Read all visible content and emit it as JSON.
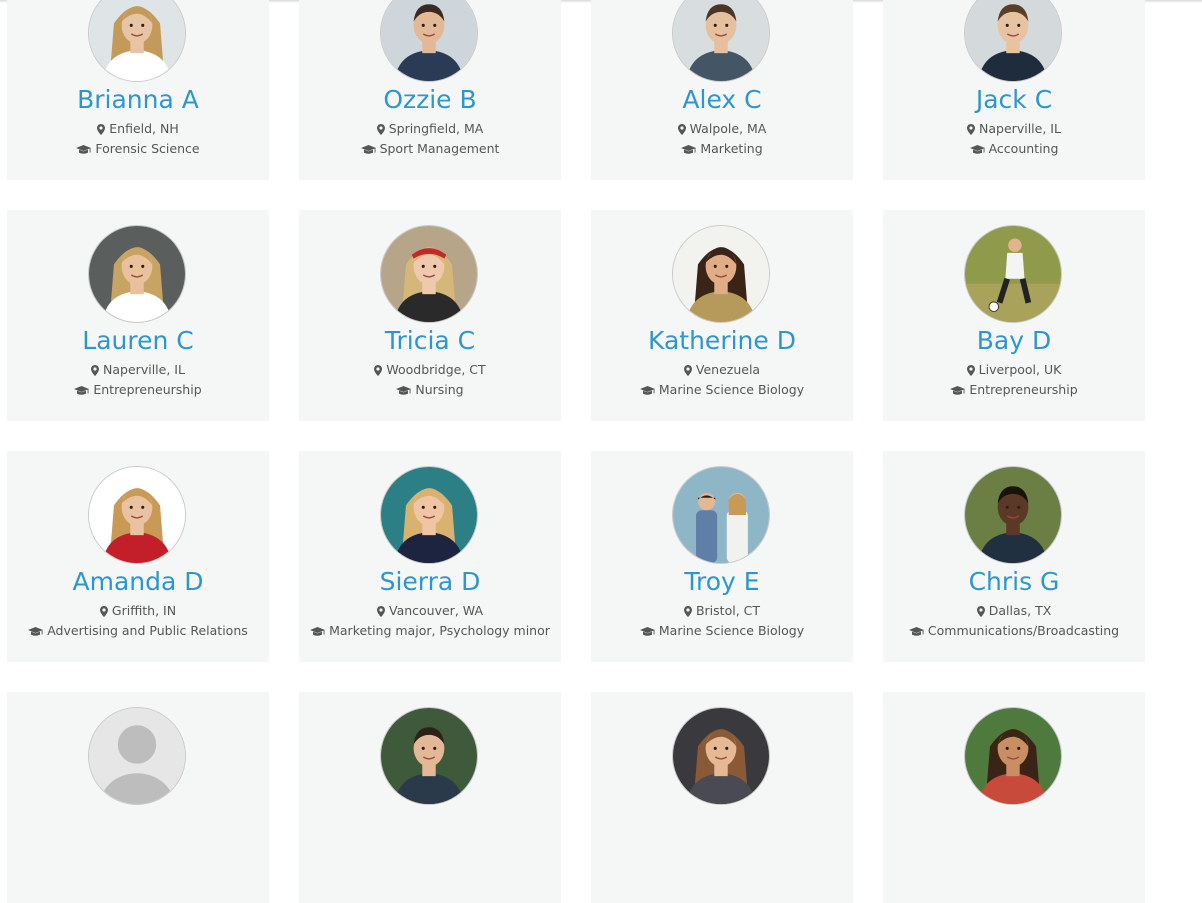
{
  "students": [
    {
      "name": "Brianna A",
      "location": "Enfield, NH",
      "major": "Forensic Science",
      "photo": "female-blonde",
      "skin": "#e7c4a4",
      "hair": "#c49a5a",
      "bg": "#dfe4e7",
      "shirt": "#ffffff"
    },
    {
      "name": "Ozzie B",
      "location": "Springfield, MA",
      "major": "Sport Management",
      "photo": "male",
      "skin": "#e2b896",
      "hair": "#3b2a20",
      "bg": "#cfd6db",
      "shirt": "#2b3b55"
    },
    {
      "name": "Alex C",
      "location": "Walpole, MA",
      "major": "Marketing",
      "photo": "male",
      "skin": "#e6bf9e",
      "hair": "#4a3626",
      "bg": "#d8dde0",
      "shirt": "#445566"
    },
    {
      "name": "Jack C",
      "location": "Naperville, IL",
      "major": "Accounting",
      "photo": "male",
      "skin": "#e8c3a2",
      "hair": "#5a3e28",
      "bg": "#d4d9dc",
      "shirt": "#1e2c3e"
    },
    {
      "name": "Lauren C",
      "location": "Naperville, IL",
      "major": "Entrepreneurship",
      "photo": "female-blonde",
      "skin": "#e9c19c",
      "hair": "#c7a463",
      "bg": "#5a5f5e",
      "shirt": "#ffffff"
    },
    {
      "name": "Tricia C",
      "location": "Woodbridge, CT",
      "major": "Nursing",
      "photo": "female-bandana",
      "skin": "#efc9ad",
      "hair": "#d6b77a",
      "bg": "#b7a58a",
      "shirt": "#2a2a2a"
    },
    {
      "name": "Katherine D",
      "location": "Venezuela",
      "major": "Marine Science Biology",
      "photo": "female-dark",
      "skin": "#e0ad86",
      "hair": "#3a2418",
      "bg": "#f2f2ee",
      "shirt": "#b59a5b"
    },
    {
      "name": "Bay D",
      "location": "Liverpool, UK",
      "major": "Entrepreneurship",
      "photo": "soccer",
      "skin": "#e2b48c",
      "hair": "#3e2c1c",
      "bg": "#8f9a4a",
      "shirt": "#f4f4f4"
    },
    {
      "name": "Amanda D",
      "location": "Griffith, IN",
      "major": "Advertising and Public Relations",
      "photo": "cheer",
      "skin": "#e9c3a1",
      "hair": "#c99a55",
      "bg": "#ffffff",
      "shirt": "#c21f2b"
    },
    {
      "name": "Sierra D",
      "location": "Vancouver, WA",
      "major": "Marketing major, Psychology minor",
      "photo": "female-blonde",
      "skin": "#efc5a4",
      "hair": "#d9b270",
      "bg": "#2d7f86",
      "shirt": "#1d2440"
    },
    {
      "name": "Troy E",
      "location": "Bristol, CT",
      "major": "Marine Science Biology",
      "photo": "couple",
      "skin": "#e3b995",
      "hair": "#3a2818",
      "bg": "#8fb6c7",
      "shirt": "#6f8fb3"
    },
    {
      "name": "Chris G",
      "location": "Dallas, TX",
      "major": "Communications/Broadcasting",
      "photo": "male-dark",
      "skin": "#5a3a26",
      "hair": "#1c120c",
      "bg": "#6b7f45",
      "shirt": "#213040"
    },
    {
      "name": "",
      "location": "",
      "major": "",
      "photo": "placeholder",
      "skin": "#c9c9c9",
      "hair": "#c9c9c9",
      "bg": "#e6e6e6",
      "shirt": "#cfcfcf"
    },
    {
      "name": "",
      "location": "",
      "major": "",
      "photo": "male",
      "skin": "#e3b896",
      "hair": "#2e2218",
      "bg": "#3e5a3a",
      "shirt": "#2a3a4a"
    },
    {
      "name": "",
      "location": "",
      "major": "",
      "photo": "female-dark",
      "skin": "#e6b893",
      "hair": "#8a5a36",
      "bg": "#3a3a3e",
      "shirt": "#4a4a55"
    },
    {
      "name": "",
      "location": "",
      "major": "",
      "photo": "female-dark",
      "skin": "#c98f63",
      "hair": "#3a2416",
      "bg": "#4f7a3e",
      "shirt": "#c84a3a"
    }
  ],
  "colors": {
    "name": "#2e96cf",
    "meta": "#555555",
    "card": "#f5f7f7"
  },
  "icons": {
    "location": "map-marker-icon",
    "major": "graduation-cap-icon"
  }
}
